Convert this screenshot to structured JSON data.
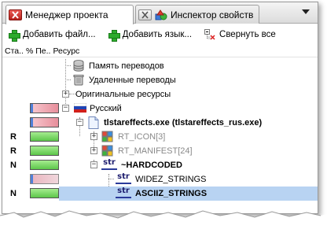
{
  "tabs": [
    {
      "label": "Менеджер проекта",
      "active": true,
      "icon": "close-icon"
    },
    {
      "label": "Инспектор свойств",
      "active": false,
      "icon": "shapes-icon"
    }
  ],
  "toolbar": {
    "add_file": "Добавить файл...",
    "add_language": "Добавить язык...",
    "collapse_all": "Свернуть все"
  },
  "columns": {
    "status": "Ста..",
    "percent": "% Пе..",
    "resource": "Ресурс"
  },
  "tree": [
    {
      "label": "Память переводов",
      "icon": "database-icon",
      "status": "",
      "bar": ""
    },
    {
      "label": "Удаленные переводы",
      "icon": "trash-icon",
      "status": "",
      "bar": ""
    },
    {
      "label": "Оригинальные ресурсы",
      "icon": "",
      "status": "",
      "bar": "",
      "expander": "+"
    },
    {
      "label": "Русский",
      "icon": "russian-flag-icon",
      "status": "",
      "bar": "pink",
      "expander": "−"
    },
    {
      "label": "tlstareffects.exe (tlstareffects_rus.exe)",
      "icon": "file-icon",
      "status": "",
      "bar": "pink",
      "expander": "−"
    },
    {
      "label": "RT_ICON[3]",
      "icon": "resource-icon",
      "status": "R",
      "bar": "green",
      "expander": "+"
    },
    {
      "label": "RT_MANIFEST[24]",
      "icon": "resource-icon",
      "status": "R",
      "bar": "green",
      "expander": "+"
    },
    {
      "label": "~HARDCODED",
      "icon": "str-icon",
      "status": "N",
      "bar": "green",
      "expander": "−"
    },
    {
      "label": "WIDEZ_STRINGS",
      "icon": "str-icon",
      "status": "",
      "bar": "tpl"
    },
    {
      "label": "ASCIIZ_STRINGS",
      "icon": "str-icon",
      "status": "N",
      "bar": "green",
      "selected": true
    }
  ],
  "str_label": "str",
  "colors": {
    "selection": "#b8d3f2",
    "green_bar": "#5cc64a",
    "pink_bar": "#e78e9b",
    "close_red": "#c9302a"
  }
}
